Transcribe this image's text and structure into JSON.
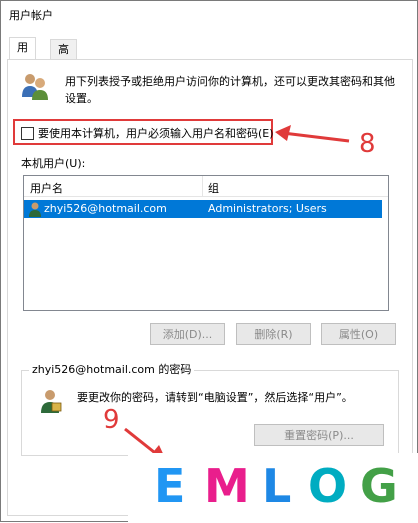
{
  "window": {
    "title": "用户帐户"
  },
  "tabs": [
    {
      "label": "用户"
    },
    {
      "label": "高级"
    }
  ],
  "description": "用下列表授予或拒绝用户访问你的计算机，还可以更改其密码和其他设置。",
  "require_password_checkbox": {
    "label": "要使用本计算机，用户必须输入用户名和密码(E)",
    "checked": false
  },
  "annotations": {
    "step1": "8",
    "step2": "9",
    "color": "#e03a3a"
  },
  "users_section": {
    "label": "本机用户(U):",
    "columns": [
      "用户名",
      "组"
    ],
    "rows": [
      {
        "username": "zhyi526@hotmail.com",
        "group": "Administrators; Users",
        "selected": true
      }
    ],
    "buttons": {
      "add": "添加(D)...",
      "remove": "删除(R)",
      "properties": "属性(O)"
    }
  },
  "password_section": {
    "title": "zhyi526@hotmail.com 的密码",
    "text": "要更改你的密码，请转到“电脑设置”，然后选择“用户”。",
    "reset_button": "重置密码(P)..."
  },
  "watermark": {
    "letters": [
      "E",
      "M",
      "L",
      "O",
      "G"
    ],
    "colors": [
      "#2196f3",
      "#e91e8c",
      "#1e88e5",
      "#00acc1",
      "#43a047"
    ]
  }
}
